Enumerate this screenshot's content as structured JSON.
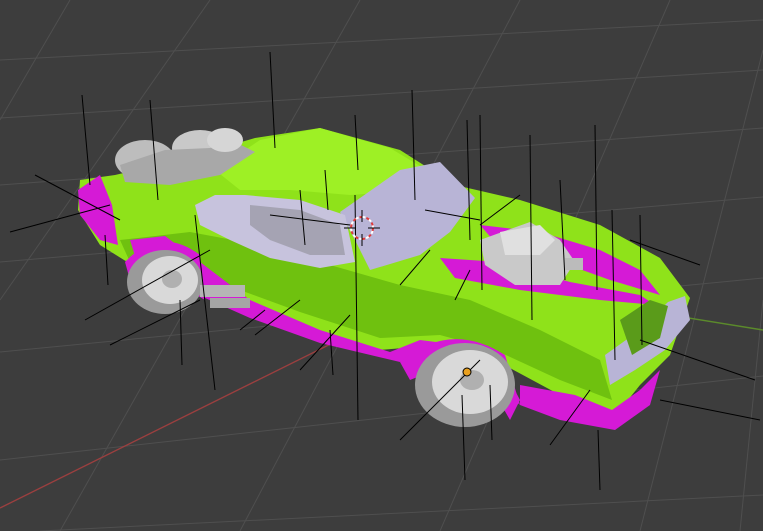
{
  "viewport": {
    "mode": "3d-viewport",
    "shading": "solid",
    "show_normals": true,
    "show_grid": true,
    "axes_visible": [
      "x",
      "y"
    ]
  },
  "colors": {
    "background": "#3d3d3d",
    "grid": "#4f4f4f",
    "x_axis": "#9b3f3f",
    "y_axis": "#5b8a2b",
    "body_green": "#8fe21a",
    "body_green_dark": "#6fc10f",
    "trim_magenta": "#d51ad6",
    "glass_lavender": "#b8b4d6",
    "chrome_grey": "#c9c9c9",
    "normal_lines": "#000000",
    "cursor_red": "#e03a3a"
  },
  "scene": {
    "object": "car-model",
    "parts": [
      "body",
      "hood-stripes",
      "side-skirt",
      "windshield",
      "side-window",
      "supercharger",
      "rear-exhaust-turbines",
      "front-wheel",
      "rear-wheel",
      "headlights"
    ]
  }
}
